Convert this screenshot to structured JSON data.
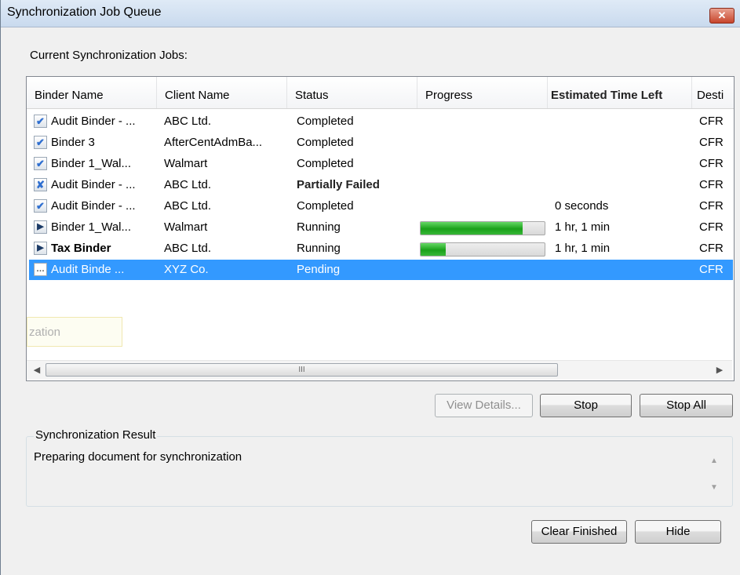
{
  "window": {
    "title": "Synchronization Job Queue",
    "close_glyph": "✕"
  },
  "jobs_label": "Current Synchronization Jobs:",
  "columns": [
    "Binder Name",
    "Client Name",
    "Status",
    "Progress",
    "Estimated Time Left",
    "Desti"
  ],
  "rows": [
    {
      "icon": "checkmark-icon",
      "binder": "Audit Binder - ...",
      "client": "ABC Ltd.",
      "status": "Completed",
      "progress": null,
      "eta": "",
      "dest": "CFR"
    },
    {
      "icon": "checkmark-icon",
      "binder": "Binder 3",
      "client": "AfterCentAdmBa...",
      "status": "Completed",
      "progress": null,
      "eta": "",
      "dest": "CFR"
    },
    {
      "icon": "checkmark-icon",
      "binder": "Binder 1_Wal...",
      "client": "Walmart",
      "status": "Completed",
      "progress": null,
      "eta": "",
      "dest": "CFR"
    },
    {
      "icon": "partial-fail-icon",
      "binder": "Audit Binder - ...",
      "client": "ABC Ltd.",
      "status": "Partially Failed",
      "progress": null,
      "eta": "",
      "dest": "CFR"
    },
    {
      "icon": "checkmark-icon",
      "binder": "Audit Binder - ...",
      "client": "ABC Ltd.",
      "status": "Completed",
      "progress": null,
      "eta": "0 seconds",
      "dest": "CFR"
    },
    {
      "icon": "play-icon",
      "binder": "Binder 1_Wal...",
      "client": "Walmart",
      "status": "Running",
      "progress": 0.82,
      "eta": "1 hr, 1 min",
      "dest": "CFR"
    },
    {
      "icon": "play-icon",
      "binder": "Tax Binder",
      "client": "ABC Ltd.",
      "status": "Running",
      "progress": 0.2,
      "eta": "1 hr, 1 min",
      "dest": "CFR"
    },
    {
      "icon": "pending-icon",
      "binder": "Audit Binde ...",
      "client": "XYZ Co.",
      "status": "Pending",
      "progress": null,
      "eta": "",
      "dest": "CFR",
      "selected": true
    }
  ],
  "ghost_tooltip": "zation",
  "hscroll": {
    "thumb_glyph": "III",
    "left_arrow": "◀",
    "right_arrow": "▶"
  },
  "buttons": {
    "view_details": "View Details...",
    "stop": "Stop",
    "stop_all": "Stop All",
    "clear_finished": "Clear Finished",
    "hide": "Hide"
  },
  "result": {
    "title": "Synchronization Result",
    "text": "Preparing document for synchronization",
    "up_arrow": "▲",
    "down_arrow": "▼"
  },
  "colors": {
    "selection": "#3399ff",
    "progress_fill": "#1aa01a",
    "close_button": "#c7452c"
  }
}
